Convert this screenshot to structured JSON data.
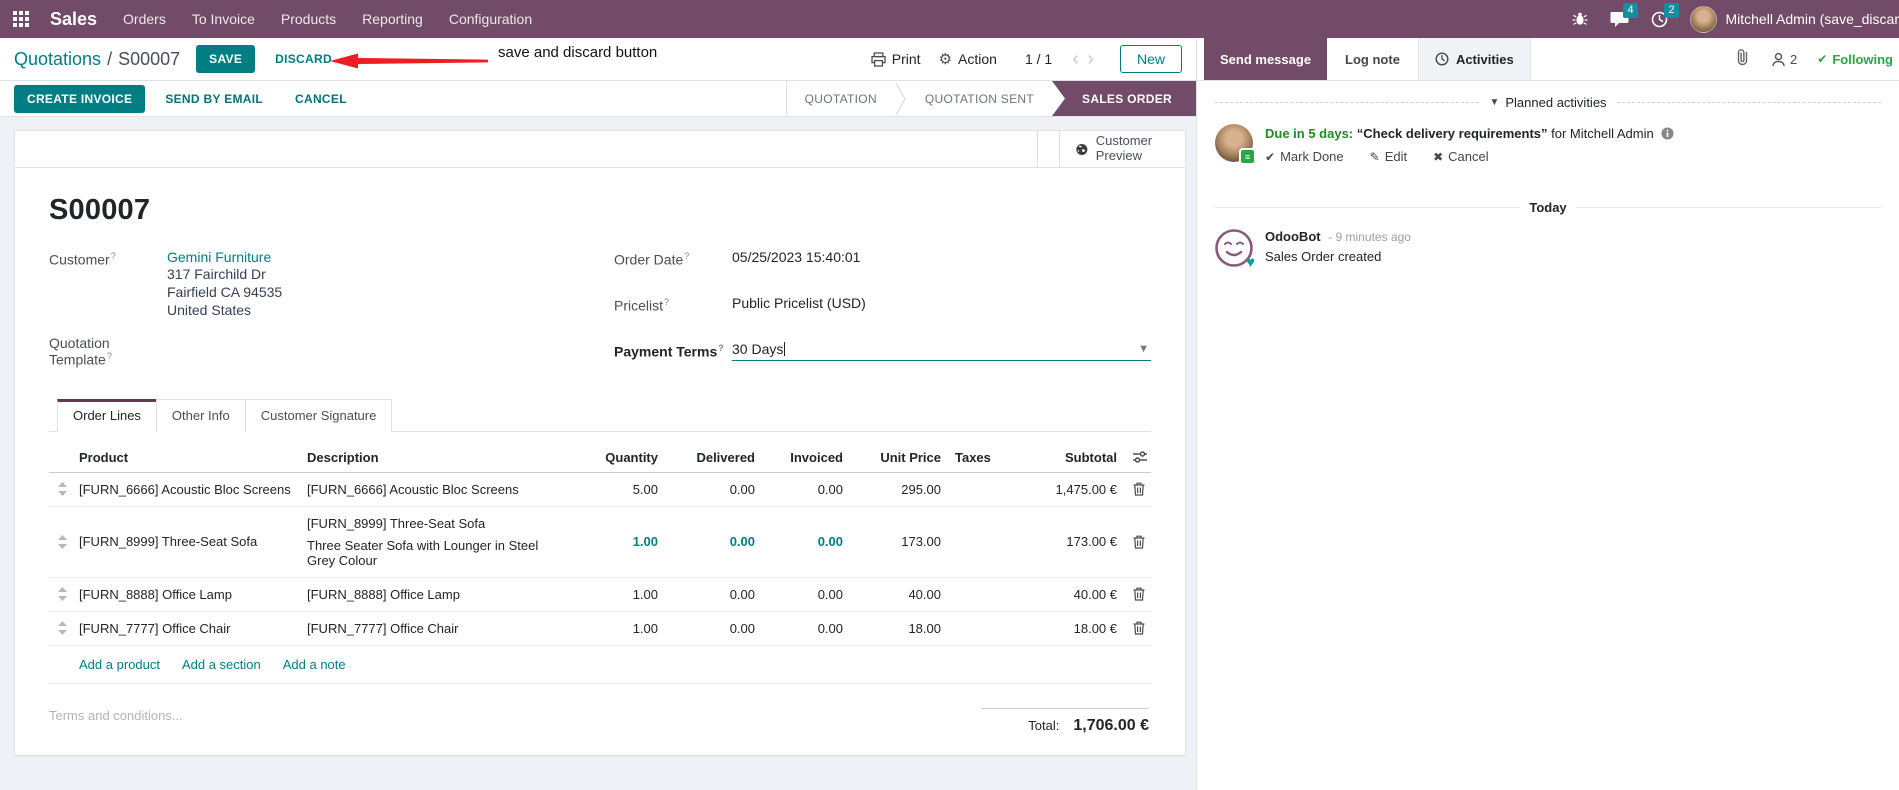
{
  "colors": {
    "brand": "#714B67",
    "primary": "#017E84",
    "badge": "#0F8FA0",
    "success": "#28A745",
    "annotation_red": "#EE1D23"
  },
  "navbar": {
    "app_name": "Sales",
    "menu_items": [
      "Orders",
      "To Invoice",
      "Products",
      "Reporting",
      "Configuration"
    ],
    "message_badge": "4",
    "activity_badge": "2",
    "user_name": "Mitchell Admin (save_discar"
  },
  "breadcrumb": {
    "parent": "Quotations",
    "separator": "/",
    "current": "S00007"
  },
  "control_panel": {
    "save_label": "SAVE",
    "discard_label": "DISCARD",
    "print_label": "Print",
    "action_label": "Action",
    "pager": "1 / 1",
    "prev_arrow": "‹",
    "next_arrow": "›",
    "new_label": "New"
  },
  "annotation": {
    "text": "save and discard button"
  },
  "action_buttons": {
    "create_invoice": "CREATE INVOICE",
    "send_by_email": "SEND BY EMAIL",
    "cancel": "CANCEL"
  },
  "statusbar": {
    "steps": [
      {
        "label": "QUOTATION",
        "active": false
      },
      {
        "label": "QUOTATION SENT",
        "active": false
      },
      {
        "label": "SALES ORDER",
        "active": true
      }
    ]
  },
  "sheet": {
    "customer_preview_label": "Customer Preview",
    "title": "S00007",
    "help_marker": "?",
    "fields": {
      "customer_label": "Customer",
      "customer_name": "Gemini Furniture",
      "customer_address": [
        "317 Fairchild Dr",
        "Fairfield CA 94535",
        "United States"
      ],
      "quotation_template_label": "Quotation Template",
      "order_date_label": "Order Date",
      "order_date_value": "05/25/2023 15:40:01",
      "pricelist_label": "Pricelist",
      "pricelist_value": "Public Pricelist (USD)",
      "payment_terms_label": "Payment Terms",
      "payment_terms_value": "30 Days",
      "dropdown_caret": "▼"
    },
    "tabs": [
      {
        "label": "Order Lines",
        "active": true
      },
      {
        "label": "Other Info",
        "active": false
      },
      {
        "label": "Customer Signature",
        "active": false
      }
    ],
    "order_lines": {
      "columns": [
        "Product",
        "Description",
        "Quantity",
        "Delivered",
        "Invoiced",
        "Unit Price",
        "Taxes",
        "Subtotal"
      ],
      "rows": [
        {
          "product": "[FURN_6666] Acoustic Bloc Screens",
          "description": "[FURN_6666] Acoustic Bloc Screens",
          "description2": "",
          "quantity": "5.00",
          "delivered": "0.00",
          "invoiced": "0.00",
          "unit_price": "295.00",
          "taxes": "",
          "subtotal": "1,475.00 €",
          "highlight": false
        },
        {
          "product": "[FURN_8999] Three-Seat Sofa",
          "description": "[FURN_8999] Three-Seat Sofa",
          "description2": "Three Seater Sofa with Lounger in Steel Grey Colour",
          "quantity": "1.00",
          "delivered": "0.00",
          "invoiced": "0.00",
          "unit_price": "173.00",
          "taxes": "",
          "subtotal": "173.00 €",
          "highlight": true
        },
        {
          "product": "[FURN_8888] Office Lamp",
          "description": "[FURN_8888] Office Lamp",
          "description2": "",
          "quantity": "1.00",
          "delivered": "0.00",
          "invoiced": "0.00",
          "unit_price": "40.00",
          "taxes": "",
          "subtotal": "40.00 €",
          "highlight": false
        },
        {
          "product": "[FURN_7777] Office Chair",
          "description": "[FURN_7777] Office Chair",
          "description2": "",
          "quantity": "1.00",
          "delivered": "0.00",
          "invoiced": "0.00",
          "unit_price": "18.00",
          "taxes": "",
          "subtotal": "18.00 €",
          "highlight": false
        }
      ],
      "add_links": [
        "Add a product",
        "Add a section",
        "Add a note"
      ]
    },
    "terms_placeholder": "Terms and conditions...",
    "total_label": "Total:",
    "total_value": "1,706.00 €"
  },
  "chatter": {
    "send_message": "Send message",
    "log_note": "Log note",
    "activities": "Activities",
    "follower_count": "2",
    "following": "Following",
    "planned_header": "Planned activities",
    "activity": {
      "due": "Due in 5 days:",
      "summary": "“Check delivery requirements”",
      "for_text": "for Mitchell Admin",
      "mark_done": "Mark Done",
      "edit": "Edit",
      "cancel": "Cancel"
    },
    "today": "Today",
    "message": {
      "author": "OdooBot",
      "time": "- 9 minutes ago",
      "body": "Sales Order created"
    }
  }
}
